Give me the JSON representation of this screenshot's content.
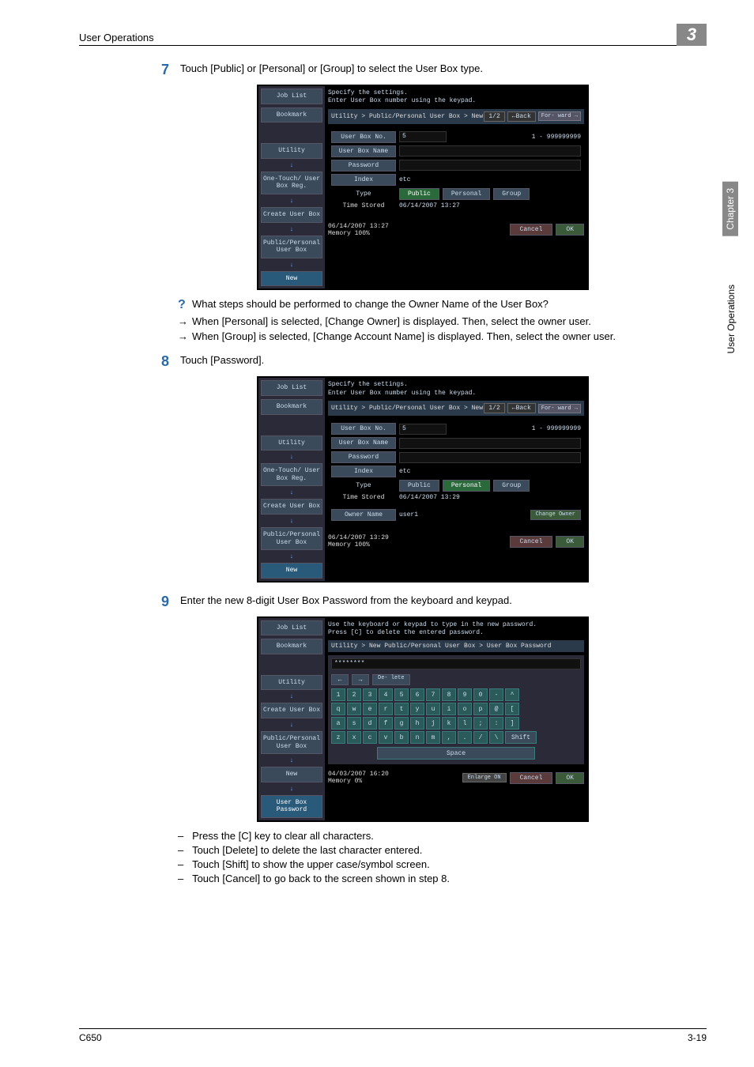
{
  "header": {
    "section": "User Operations"
  },
  "chapter_box": "3",
  "side_tab": {
    "chapter": "Chapter 3",
    "title": "User Operations"
  },
  "step7": {
    "num": "7",
    "text": "Touch [Public] or [Personal] or [Group] to select the User Box type."
  },
  "tip7": {
    "q": "What steps should be performed to change the Owner Name of the User Box?",
    "a1": "When [Personal] is selected, [Change Owner] is displayed. Then, select the owner user.",
    "a2": "When [Group] is selected, [Change Account Name] is displayed. Then, select the owner user."
  },
  "step8": {
    "num": "8",
    "text": "Touch [Password]."
  },
  "step9": {
    "num": "9",
    "text": "Enter the new 8-digit User Box Password from the keyboard and keypad."
  },
  "notes9": {
    "n1": "Press the [C] key to clear all characters.",
    "n2": "Touch [Delete] to delete the last character entered.",
    "n3": "Touch [Shift] to show the upper case/symbol screen.",
    "n4": "Touch [Cancel] to go back to the screen shown in step 8."
  },
  "shot1": {
    "side": {
      "job_list": "Job List",
      "bookmark": "Bookmark",
      "utility": "Utility",
      "onetouch": "One-Touch/\nUser Box Reg.",
      "create": "Create User Box",
      "pubper": "Public/Personal\nUser Box",
      "new": "New"
    },
    "header1": "Specify the settings.",
    "header2": "Enter User Box number using the keypad.",
    "crumb": "Utility > Public/Personal User Box > New",
    "page": "1/2",
    "back": "←Back",
    "fwd": "For-\nward →",
    "box_no_label": "User Box No.",
    "box_no_val": "5",
    "box_no_range": "1 - 999999999",
    "box_name_label": "User Box Name",
    "password_label": "Password",
    "index_label": "Index",
    "index_val": "etc",
    "type_label": "Type",
    "type_public": "Public",
    "type_personal": "Personal",
    "type_group": "Group",
    "time_label": "Time\nStored",
    "time_val": "06/14/2007   13:27",
    "footer_date": "06/14/2007    13:27",
    "footer_mem": "Memory          100%",
    "cancel": "Cancel",
    "ok": "OK"
  },
  "shot2": {
    "header1": "Specify the settings.",
    "header2": "Enter User Box number using the keypad.",
    "crumb": "Utility > Public/Personal User Box > New",
    "page": "1/2",
    "time_val": "06/14/2007   13:29",
    "owner_label": "Owner Name",
    "owner_val": "user1",
    "change_owner": "Change\nOwner",
    "footer_date": "06/14/2007    13:29",
    "footer_mem": "Memory          100%"
  },
  "shot3": {
    "side": {
      "job_list": "Job List",
      "bookmark": "Bookmark",
      "utility": "Utility",
      "create": "Create User Box",
      "pubper": "Public/Personal\nUser Box",
      "new": "New",
      "ubpass": "User Box\nPassword"
    },
    "header1": "Use the keyboard or keypad to type in the new password.",
    "header2": "Press [C] to delete the entered password.",
    "crumb": "Utility > New Public/Personal User Box > User Box Password",
    "input": "********",
    "delete": "De-\nlete",
    "row1": [
      "1",
      "2",
      "3",
      "4",
      "5",
      "6",
      "7",
      "8",
      "9",
      "0",
      "-",
      "^"
    ],
    "row2": [
      "q",
      "w",
      "e",
      "r",
      "t",
      "y",
      "u",
      "i",
      "o",
      "p",
      "@",
      "["
    ],
    "row3": [
      "a",
      "s",
      "d",
      "f",
      "g",
      "h",
      "j",
      "k",
      "l",
      ";",
      ":",
      "]"
    ],
    "row4": [
      "z",
      "x",
      "c",
      "v",
      "b",
      "n",
      "m",
      ",",
      ".",
      "/",
      "\\"
    ],
    "shift": "Shift",
    "space": "Space",
    "enlarge": "Enlarge\nON",
    "footer_date": "04/03/2007    16:20",
    "footer_mem": "Memory            0%",
    "cancel": "Cancel",
    "ok": "OK"
  },
  "footer": {
    "left": "C650",
    "right": "3-19"
  }
}
